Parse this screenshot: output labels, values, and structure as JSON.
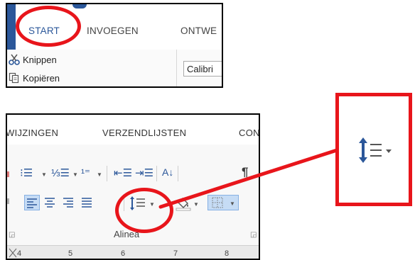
{
  "top": {
    "tabs": [
      {
        "label": "START",
        "active": true
      },
      {
        "label": "INVOEGEN",
        "active": false
      },
      {
        "label": "ONTWE",
        "active": false
      }
    ],
    "clipboard": {
      "cut_label": "Knippen",
      "copy_label": "Kopiëren"
    },
    "font_name": "Calibri"
  },
  "bottom": {
    "tabs": [
      "WIJZINGEN",
      "VERZENDLIJSTEN",
      "CONT"
    ],
    "group_label": "Alinea",
    "ruler_numbers": [
      "4",
      "5",
      "6",
      "7",
      "8"
    ]
  },
  "icons": {
    "cut": "scissors-icon",
    "copy": "copy-icon",
    "bullets": "bullet-list-icon",
    "numbering": "numbered-list-icon",
    "multilevel": "multilevel-list-icon",
    "decrease_indent": "decrease-indent-icon",
    "increase_indent": "increase-indent-icon",
    "sort": "sort-az-icon",
    "pilcrow": "show-formatting-icon",
    "line_spacing": "line-spacing-icon",
    "shading": "shading-bucket-icon",
    "borders": "borders-icon"
  },
  "colors": {
    "accent": "#2b579a",
    "highlight": "#e8151b",
    "selected": "#c6dcf5"
  }
}
